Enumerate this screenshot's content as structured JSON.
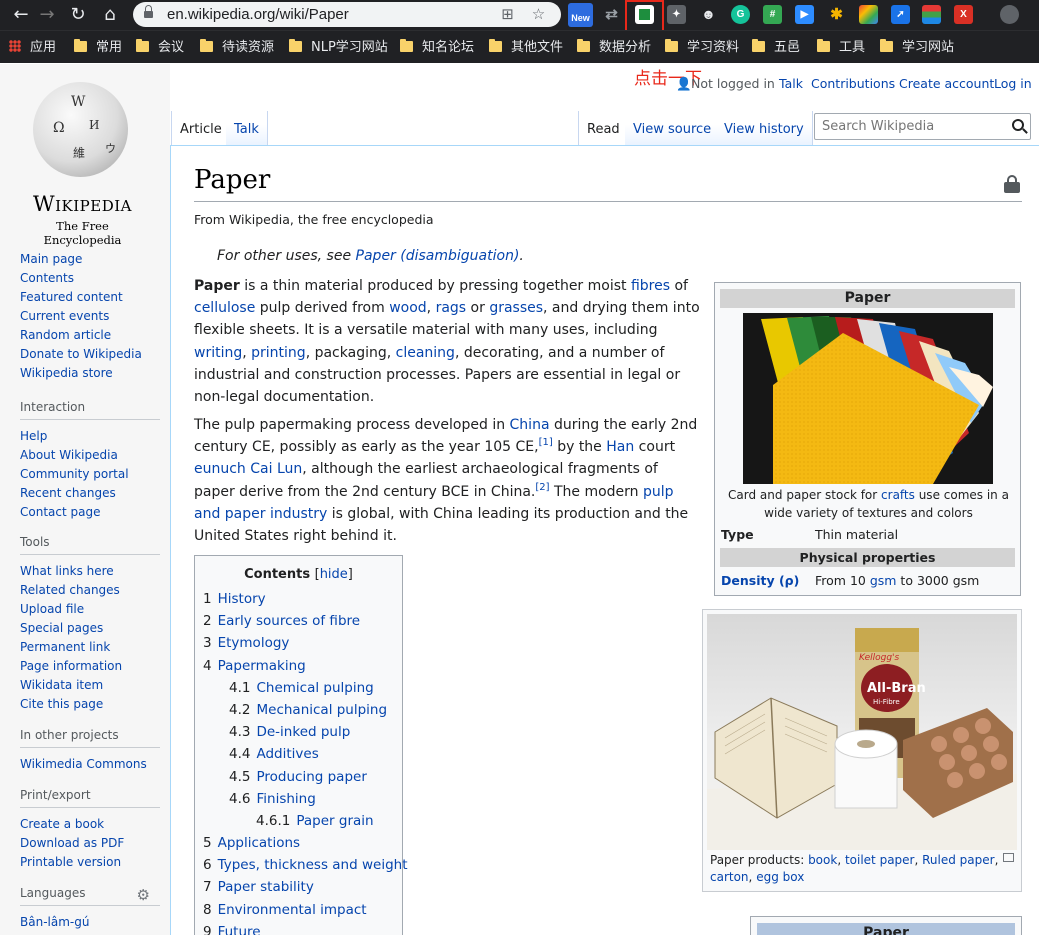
{
  "browser": {
    "url": "en.wikipedia.org/wiki/Paper",
    "extension_new_badge": "New",
    "bookmarks": [
      "应用",
      "常用",
      "会议",
      "待读资源",
      "NLP学习网站",
      "知名论坛",
      "其他文件",
      "数据分析",
      "学习资料",
      "五邑",
      "工具",
      "学习网站"
    ]
  },
  "annotation": "点击一下",
  "personal": {
    "not_logged_in": "Not logged in",
    "talk": "Talk",
    "contributions": "Contributions",
    "create_account": "Create account",
    "log_in": "Log in"
  },
  "logo": {
    "wordmark": "Wikipedia",
    "tagline": "The Free Encyclopedia"
  },
  "tabs": {
    "article": "Article",
    "talk": "Talk",
    "read": "Read",
    "view_source": "View source",
    "view_history": "View history"
  },
  "search": {
    "placeholder": "Search Wikipedia"
  },
  "sidebar": {
    "main": [
      "Main page",
      "Contents",
      "Featured content",
      "Current events",
      "Random article",
      "Donate to Wikipedia",
      "Wikipedia store"
    ],
    "interaction": {
      "heading": "Interaction",
      "items": [
        "Help",
        "About Wikipedia",
        "Community portal",
        "Recent changes",
        "Contact page"
      ]
    },
    "tools": {
      "heading": "Tools",
      "items": [
        "What links here",
        "Related changes",
        "Upload file",
        "Special pages",
        "Permanent link",
        "Page information",
        "Wikidata item",
        "Cite this page"
      ]
    },
    "other_projects": {
      "heading": "In other projects",
      "items": [
        "Wikimedia Commons"
      ]
    },
    "print_export": {
      "heading": "Print/export",
      "items": [
        "Create a book",
        "Download as PDF",
        "Printable version"
      ]
    },
    "languages": {
      "heading": "Languages",
      "items": [
        "Bân-lâm-gú"
      ]
    }
  },
  "article": {
    "title": "Paper",
    "from": "From Wikipedia, the free encyclopedia",
    "hatnote_prefix": "For other uses, see ",
    "hatnote_link": "Paper (disambiguation)",
    "hatnote_suffix": "."
  },
  "toc": {
    "title": "Contents",
    "hide": "hide",
    "items": [
      {
        "num": "1",
        "label": "History",
        "level": 1
      },
      {
        "num": "2",
        "label": "Early sources of fibre",
        "level": 1
      },
      {
        "num": "3",
        "label": "Etymology",
        "level": 1
      },
      {
        "num": "4",
        "label": "Papermaking",
        "level": 1
      },
      {
        "num": "4.1",
        "label": "Chemical pulping",
        "level": 2
      },
      {
        "num": "4.2",
        "label": "Mechanical pulping",
        "level": 2
      },
      {
        "num": "4.3",
        "label": "De-inked pulp",
        "level": 2
      },
      {
        "num": "4.4",
        "label": "Additives",
        "level": 2
      },
      {
        "num": "4.5",
        "label": "Producing paper",
        "level": 2
      },
      {
        "num": "4.6",
        "label": "Finishing",
        "level": 2
      },
      {
        "num": "4.6.1",
        "label": "Paper grain",
        "level": 3
      },
      {
        "num": "5",
        "label": "Applications",
        "level": 1
      },
      {
        "num": "6",
        "label": "Types, thickness and weight",
        "level": 1
      },
      {
        "num": "7",
        "label": "Paper stability",
        "level": 1
      },
      {
        "num": "8",
        "label": "Environmental impact",
        "level": 1
      },
      {
        "num": "9",
        "label": "Future",
        "level": 1
      }
    ]
  },
  "infobox": {
    "title": "Paper",
    "caption_prefix": "Card and paper stock for ",
    "caption_link": "crafts",
    "caption_suffix": " use comes in a wide variety of textures and colors",
    "type_label": "Type",
    "type_value": "Thin material",
    "physical": "Physical properties",
    "density_label": "Density (ρ)",
    "density_from": "From 10 ",
    "density_gsm1": "gsm",
    "density_to": " to 3000 gsm"
  },
  "thumb": {
    "caption_prefix": "Paper products: ",
    "links": [
      "book",
      "toilet paper",
      "Ruled paper",
      "carton",
      "egg box"
    ],
    "box_brand": "Kellogg's",
    "box_name": "All-Bran",
    "box_sub": "Hi-Fibre"
  },
  "infobox2_title": "Paper"
}
